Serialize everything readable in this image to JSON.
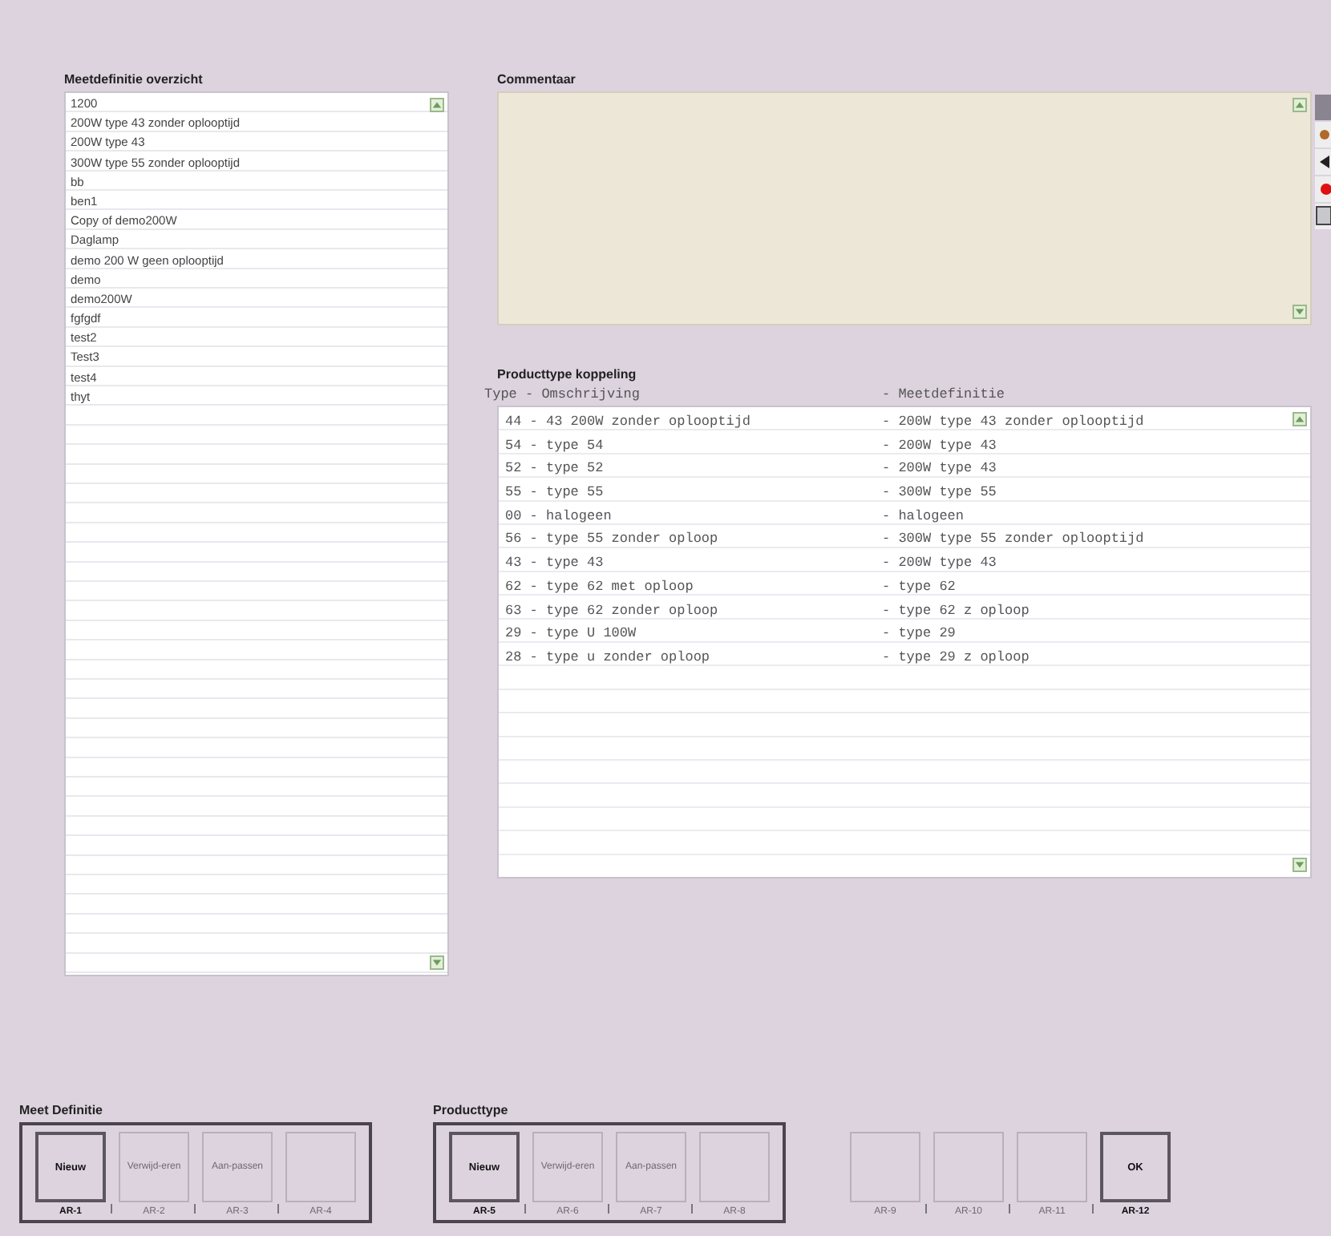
{
  "measure_list": {
    "title": "Meetdefinitie overzicht",
    "items": [
      {
        "label": "1200"
      },
      {
        "label": "200W type 43 zonder oplooptijd"
      },
      {
        "label": "200W type 43"
      },
      {
        "label": "300W type 55 zonder oplooptijd"
      },
      {
        "label": "bb"
      },
      {
        "label": "ben1"
      },
      {
        "label": "Copy of demo200W"
      },
      {
        "label": "Daglamp"
      },
      {
        "label": "demo 200 W geen oplooptijd"
      },
      {
        "label": "demo"
      },
      {
        "label": "demo200W"
      },
      {
        "label": "fgfgdf"
      },
      {
        "label": "test2"
      },
      {
        "label": "Test3"
      },
      {
        "label": "test4"
      },
      {
        "label": "thyt"
      }
    ]
  },
  "comment": {
    "title": "Commentaar"
  },
  "coupling": {
    "title": "Producttype koppeling",
    "header_left": "Type - Omschrijving",
    "header_right": "- Meetdefinitie",
    "rows": [
      {
        "type": "44 - 43 200W zonder oplooptijd",
        "definition": "- 200W type 43 zonder oplooptijd"
      },
      {
        "type": "54 - type 54",
        "definition": "- 200W type 43"
      },
      {
        "type": "52 - type 52",
        "definition": "- 200W type 43"
      },
      {
        "type": "55 - type 55",
        "definition": "- 300W type 55"
      },
      {
        "type": "00 - halogeen",
        "definition": "- halogeen"
      },
      {
        "type": "56 - type 55 zonder oploop",
        "definition": "- 300W type 55 zonder oplooptijd"
      },
      {
        "type": "43 - type 43",
        "definition": "- 200W type 43"
      },
      {
        "type": "62 - type 62 met oploop",
        "definition": "- type 62"
      },
      {
        "type": "63 - type 62 zonder oploop",
        "definition": "- type 62 z oploop"
      },
      {
        "type": "29 - type U 100W",
        "definition": "- type 29"
      },
      {
        "type": "28 - type u zonder oploop",
        "definition": "- type 29 z oploop"
      }
    ]
  },
  "button_groups": [
    {
      "title": "Meet Definitie",
      "framed": true,
      "buttons": [
        {
          "label": "Nieuw",
          "key": "AR-1",
          "disabled": false
        },
        {
          "label": "Verwijd-eren",
          "key": "AR-2",
          "disabled": true
        },
        {
          "label": "Aan-passen",
          "key": "AR-3",
          "disabled": true
        },
        {
          "key": "AR-4",
          "disabled": true
        }
      ]
    },
    {
      "title": "Producttype",
      "framed": true,
      "buttons": [
        {
          "label": "Nieuw",
          "key": "AR-5",
          "disabled": false
        },
        {
          "label": "Verwijd-eren",
          "key": "AR-6",
          "disabled": true
        },
        {
          "label": "Aan-passen",
          "key": "AR-7",
          "disabled": true
        },
        {
          "key": "AR-8",
          "disabled": true
        }
      ]
    },
    {
      "framed": false,
      "buttons": [
        {
          "key": "AR-9",
          "disabled": true
        },
        {
          "key": "AR-10",
          "disabled": true
        },
        {
          "key": "AR-11",
          "disabled": true
        },
        {
          "label": "OK",
          "key": "AR-12",
          "disabled": false
        }
      ]
    }
  ]
}
